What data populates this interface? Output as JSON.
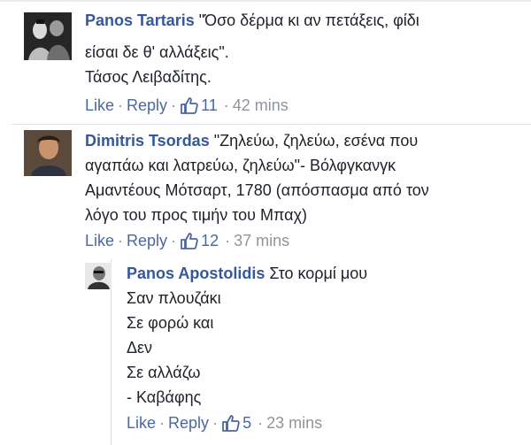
{
  "comments": [
    {
      "author": "Panos Tartaris",
      "lines": [
        "\"Όσο δέρμα κι αν πετάξεις, φίδι",
        "είσαι δε θ' αλλάξεις\".",
        "Τάσος Λειβαδίτης."
      ],
      "actions": {
        "like": "Like",
        "reply": "Reply",
        "likes": "11",
        "time": "42 mins"
      }
    },
    {
      "author": "Dimitris Tsordas",
      "lines": [
        "\"Ζηλεύω, ζηλεύω, εσένα που",
        "αγαπάω και λατρεύω, ζηλεύω\"- Βόλφγκανγκ",
        "Αμαντέους Μότσαρτ, 1780 (απόσπασμα από τον",
        "λόγο του προς τιμήν του Μπαχ)"
      ],
      "actions": {
        "like": "Like",
        "reply": "Reply",
        "likes": "12",
        "time": "37 mins"
      }
    }
  ],
  "reply": {
    "author": "Panos Apostolidis",
    "lines": [
      "Στο κορμί μου",
      "Σαν πλουζάκι",
      "Σε φορώ και",
      "Δεν",
      "Σε αλλάζω",
      "- Καβάφης"
    ],
    "actions": {
      "like": "Like",
      "reply": "Reply",
      "likes": "5",
      "time": "23 mins"
    }
  },
  "separator": "·",
  "icons": {
    "like": "thumbs-up-icon"
  },
  "colors": {
    "author": "#365899",
    "link": "#4b67a1",
    "meta": "#90949c",
    "text": "#1d2129"
  }
}
